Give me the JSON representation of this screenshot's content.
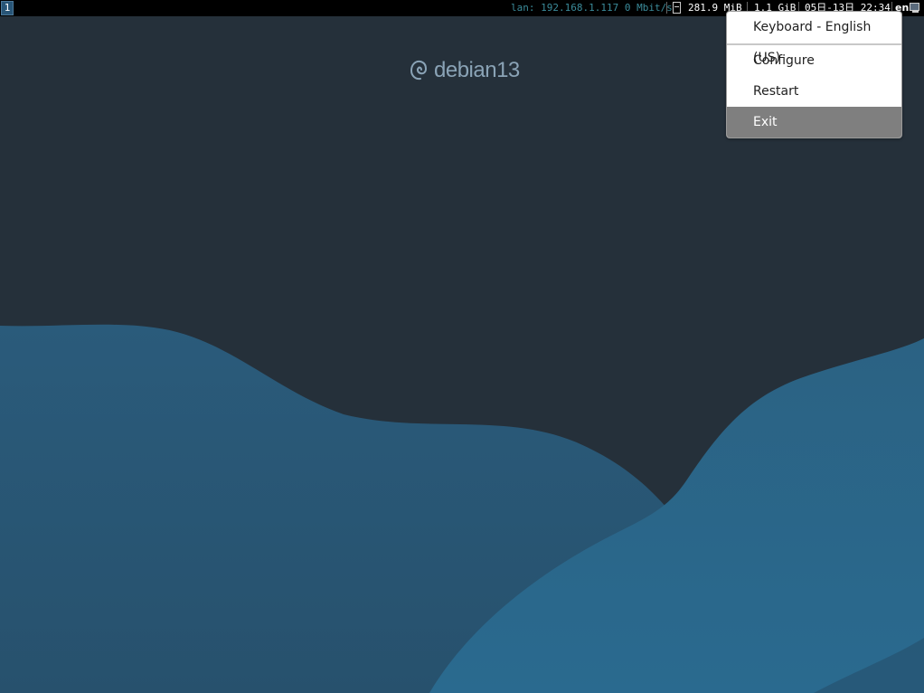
{
  "desktop": {
    "background_color": "#25303a",
    "wave_colors": [
      "#2b5d7e",
      "#2d6486",
      "#24506c"
    ]
  },
  "logo": {
    "text": "debian13",
    "icon": "debian-swirl-icon",
    "color": "#8aa3b6"
  },
  "topbar": {
    "workspace": "1",
    "status": {
      "lan": "lan: 192.168.1.117 0 Mbit/s",
      "disk_icon": "disk-icon",
      "memory": "281.9 MiB",
      "swap": "1.1 GiB",
      "clock": "05日-13日 22:34",
      "language": "en",
      "tray_icon": "monitor-icon"
    },
    "colors": {
      "background": "#000000",
      "lan_text": "#3b8b9a",
      "workspace_bg": "#285577"
    }
  },
  "context_menu": {
    "header": "Keyboard - English (US)",
    "items": [
      {
        "label": "Configure",
        "highlighted": false
      },
      {
        "label": "Restart",
        "highlighted": false
      },
      {
        "label": "Exit",
        "highlighted": true
      }
    ],
    "highlight_color": "#7f7f7f"
  }
}
